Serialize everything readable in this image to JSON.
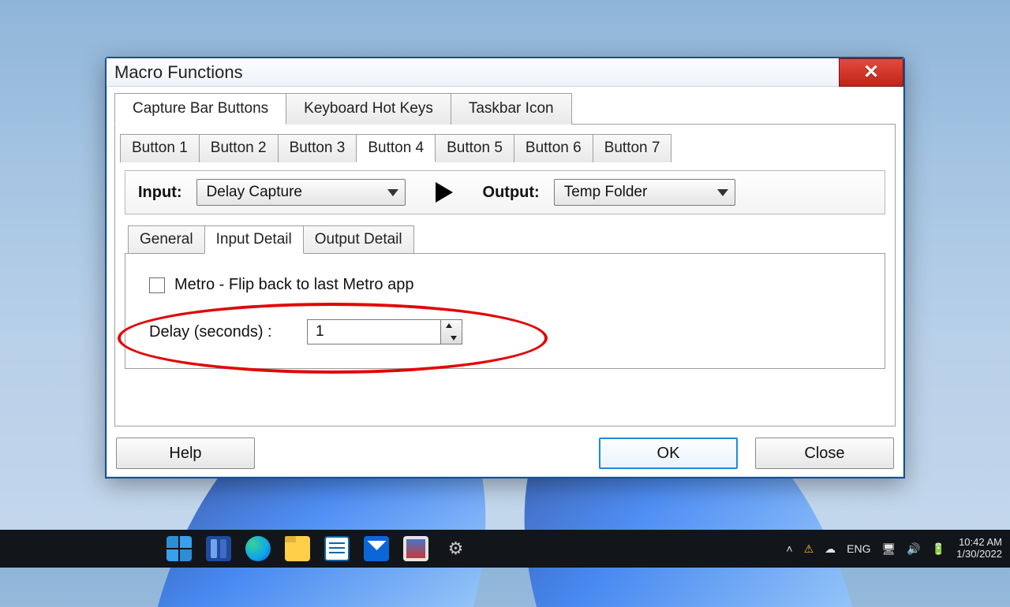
{
  "dialog": {
    "title": "Macro Functions",
    "main_tabs": [
      "Capture Bar Buttons",
      "Keyboard Hot Keys",
      "Taskbar Icon"
    ],
    "main_active": 0,
    "button_tabs": [
      "Button 1",
      "Button 2",
      "Button 3",
      "Button 4",
      "Button 5",
      "Button 6",
      "Button 7"
    ],
    "button_active": 3,
    "input_label": "Input:",
    "input_value": "Delay Capture",
    "output_label": "Output:",
    "output_value": "Temp Folder",
    "detail_tabs": [
      "General",
      "Input Detail",
      "Output Detail"
    ],
    "detail_active": 1,
    "metro_checkbox_label": "Metro - Flip back to last Metro app",
    "delay_label": "Delay (seconds) :",
    "delay_value": "1",
    "buttons": {
      "help": "Help",
      "ok": "OK",
      "close": "Close"
    }
  },
  "taskbar": {
    "lang": "ENG",
    "time": "10:42 AM",
    "date": "1/30/2022"
  }
}
